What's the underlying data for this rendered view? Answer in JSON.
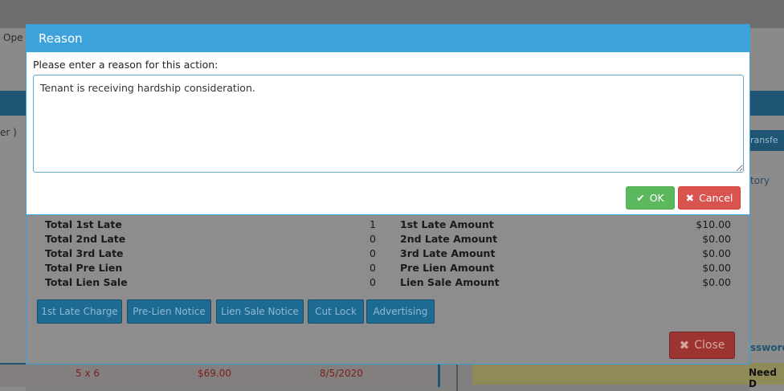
{
  "background": {
    "top_text": "Ope",
    "left_text": "er )",
    "transfer_text": "ransfe",
    "history_text": "tory",
    "password_text": "ssword",
    "need_text": "Need D",
    "row": {
      "size": "5 x 6",
      "price": "$69.00",
      "date": "8/5/2020"
    }
  },
  "late_notices": {
    "stats": [
      {
        "label": "Total 1st Late",
        "count": "1",
        "amount_label": "1st Late Amount",
        "amount": "$10.00"
      },
      {
        "label": "Total 2nd Late",
        "count": "0",
        "amount_label": "2nd Late Amount",
        "amount": "$0.00"
      },
      {
        "label": "Total 3rd Late",
        "count": "0",
        "amount_label": "3rd Late Amount",
        "amount": "$0.00"
      },
      {
        "label": "Total Pre Lien",
        "count": "0",
        "amount_label": "Pre Lien Amount",
        "amount": "$0.00"
      },
      {
        "label": "Total Lien Sale",
        "count": "0",
        "amount_label": "Lien Sale Amount",
        "amount": "$0.00"
      }
    ],
    "buttons": [
      "1st Late Charge",
      "Pre-Lien Notice",
      "Lien Sale Notice",
      "Cut Lock",
      "Advertising"
    ],
    "close_label": "Close"
  },
  "dialog": {
    "title": "Reason",
    "prompt": "Please enter a reason for this action:",
    "reason_value": "Tenant is receiving hardship consideration.",
    "ok_label": "OK",
    "cancel_label": "Cancel"
  },
  "colors": {
    "header": "#3ea3dd",
    "ok": "#5cb85c",
    "cancel": "#d9534f"
  }
}
